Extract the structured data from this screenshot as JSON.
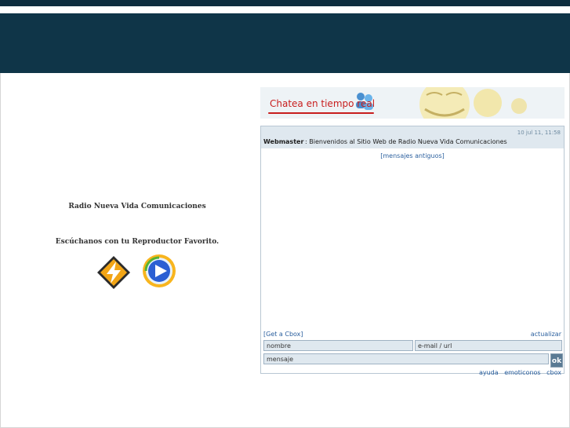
{
  "left": {
    "station_name": "Radio Nueva Vida Comunicaciones",
    "listen_text": "Escúchanos con tu Reproductor Favorito.",
    "players": [
      "winamp-icon",
      "windows-media-player-icon"
    ]
  },
  "chat": {
    "banner_text": "Chatea en tiempo real",
    "message": {
      "timestamp": "10 jul 11, 11:58",
      "user": "Webmaster",
      "text": ": Bienvenidos al Sitio Web de Radio Nueva Vida Comunicaciones"
    },
    "old_messages_link": "[mensajes antiguos]",
    "get_cbox_link": "[Get a Cbox]",
    "refresh_link": "actualizar",
    "name_placeholder": "nombre",
    "email_placeholder": "e-mail / url",
    "message_placeholder": "mensaje",
    "ok_label": "ok",
    "footer_links": [
      "ayuda",
      "emoticonos",
      "cbox"
    ]
  },
  "colors": {
    "header": "#0f3548",
    "topbar": "#0d2d3e",
    "chat_row": "#dfe8ef",
    "link": "#2a5f9e"
  }
}
